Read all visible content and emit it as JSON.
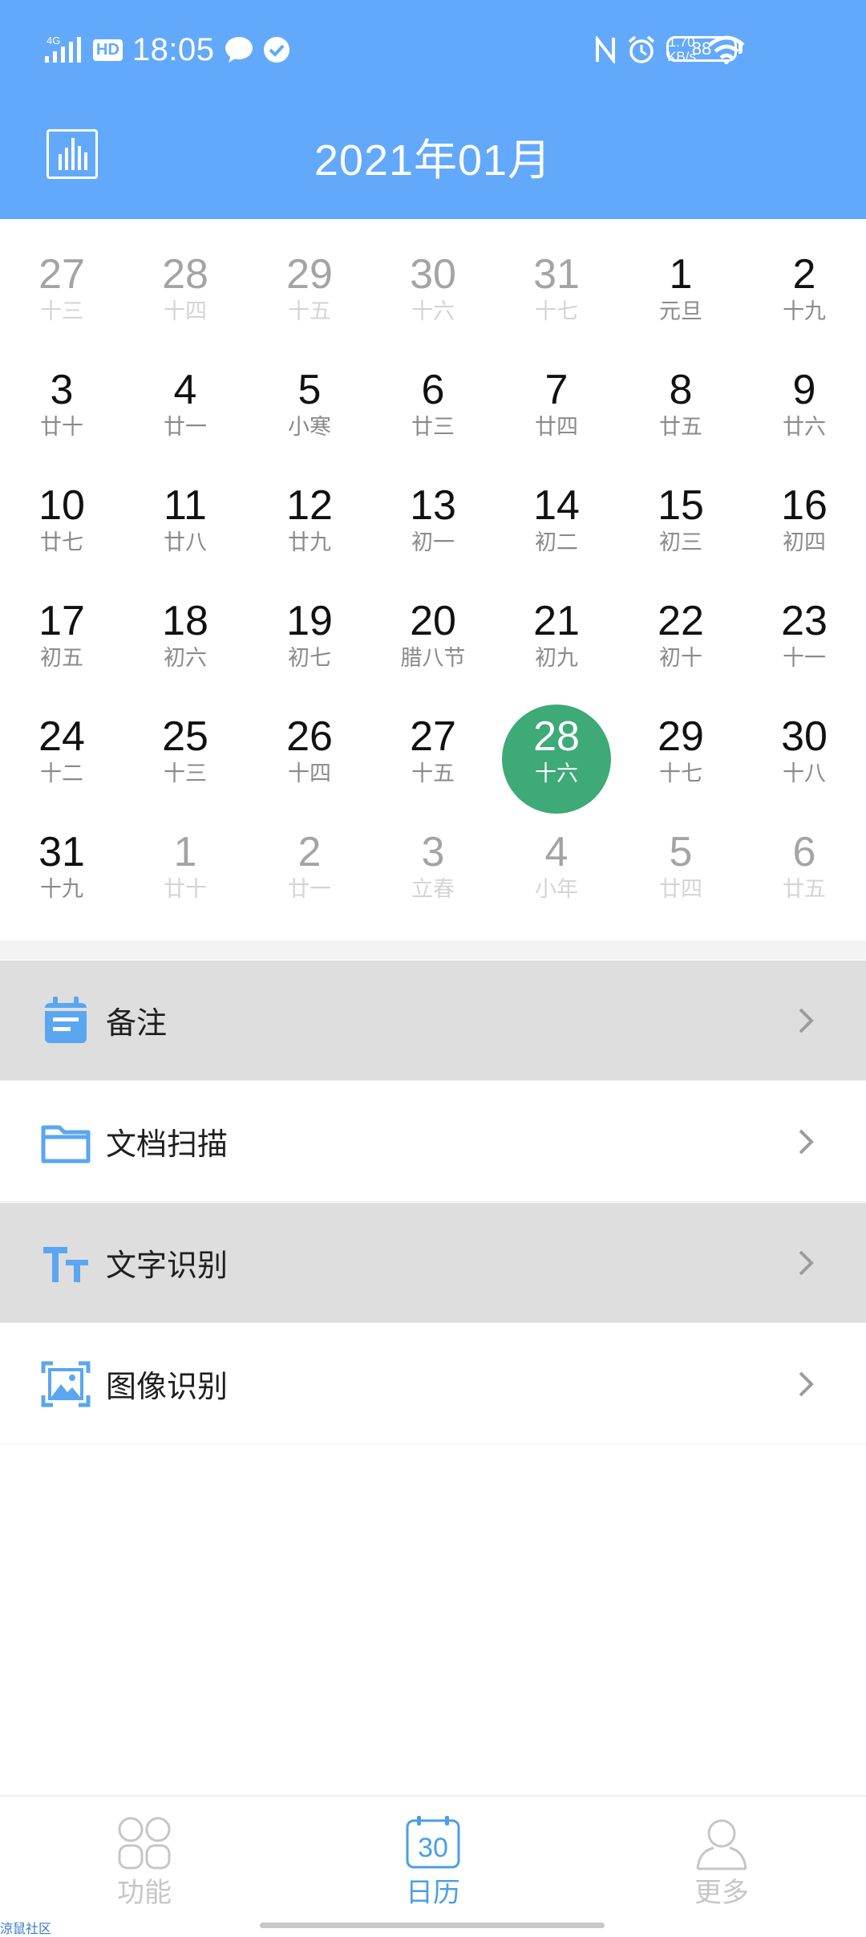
{
  "status_bar": {
    "network": "4G",
    "hd": "HD",
    "time": "18:05",
    "speed_value": "1.70",
    "speed_unit": "KB/s",
    "battery": "88"
  },
  "header": {
    "title": "2021年01月",
    "chart_icon": "bar-chart-icon"
  },
  "calendar": {
    "weeks": [
      [
        {
          "day": "27",
          "lunar": "十三",
          "other": true
        },
        {
          "day": "28",
          "lunar": "十四",
          "other": true
        },
        {
          "day": "29",
          "lunar": "十五",
          "other": true
        },
        {
          "day": "30",
          "lunar": "十六",
          "other": true
        },
        {
          "day": "31",
          "lunar": "十七",
          "other": true
        },
        {
          "day": "1",
          "lunar": "元旦"
        },
        {
          "day": "2",
          "lunar": "十九"
        }
      ],
      [
        {
          "day": "3",
          "lunar": "廿十"
        },
        {
          "day": "4",
          "lunar": "廿一"
        },
        {
          "day": "5",
          "lunar": "小寒"
        },
        {
          "day": "6",
          "lunar": "廿三"
        },
        {
          "day": "7",
          "lunar": "廿四"
        },
        {
          "day": "8",
          "lunar": "廿五"
        },
        {
          "day": "9",
          "lunar": "廿六"
        }
      ],
      [
        {
          "day": "10",
          "lunar": "廿七"
        },
        {
          "day": "11",
          "lunar": "廿八"
        },
        {
          "day": "12",
          "lunar": "廿九"
        },
        {
          "day": "13",
          "lunar": "初一"
        },
        {
          "day": "14",
          "lunar": "初二"
        },
        {
          "day": "15",
          "lunar": "初三"
        },
        {
          "day": "16",
          "lunar": "初四"
        }
      ],
      [
        {
          "day": "17",
          "lunar": "初五"
        },
        {
          "day": "18",
          "lunar": "初六"
        },
        {
          "day": "19",
          "lunar": "初七"
        },
        {
          "day": "20",
          "lunar": "腊八节"
        },
        {
          "day": "21",
          "lunar": "初九"
        },
        {
          "day": "22",
          "lunar": "初十"
        },
        {
          "day": "23",
          "lunar": "十一"
        }
      ],
      [
        {
          "day": "24",
          "lunar": "十二"
        },
        {
          "day": "25",
          "lunar": "十三"
        },
        {
          "day": "26",
          "lunar": "十四"
        },
        {
          "day": "27",
          "lunar": "十五"
        },
        {
          "day": "28",
          "lunar": "十六",
          "today": true
        },
        {
          "day": "29",
          "lunar": "十七"
        },
        {
          "day": "30",
          "lunar": "十八"
        }
      ],
      [
        {
          "day": "31",
          "lunar": "十九"
        },
        {
          "day": "1",
          "lunar": "廿十",
          "other": true
        },
        {
          "day": "2",
          "lunar": "廿一",
          "other": true
        },
        {
          "day": "3",
          "lunar": "立春",
          "other": true
        },
        {
          "day": "4",
          "lunar": "小年",
          "other": true
        },
        {
          "day": "5",
          "lunar": "廿四",
          "other": true
        },
        {
          "day": "6",
          "lunar": "廿五",
          "other": true
        }
      ]
    ],
    "today_color": "#3daa77"
  },
  "menu": {
    "items": [
      {
        "label": "备注",
        "icon": "note-icon"
      },
      {
        "label": "文档扫描",
        "icon": "folder-icon"
      },
      {
        "label": "文字识别",
        "icon": "text-icon"
      },
      {
        "label": "图像识别",
        "icon": "image-icon"
      }
    ],
    "accent": "#5aa6f0"
  },
  "bottom_nav": {
    "items": [
      {
        "label": "功能",
        "icon": "grid-icon",
        "active": false
      },
      {
        "label": "日历",
        "icon": "calendar-icon",
        "active": true,
        "icon_text": "30"
      },
      {
        "label": "更多",
        "icon": "person-icon",
        "active": false
      }
    ],
    "active_color": "#4a9fe6",
    "inactive_color": "#c6c6c6"
  },
  "watermark": "涼鼠社区"
}
